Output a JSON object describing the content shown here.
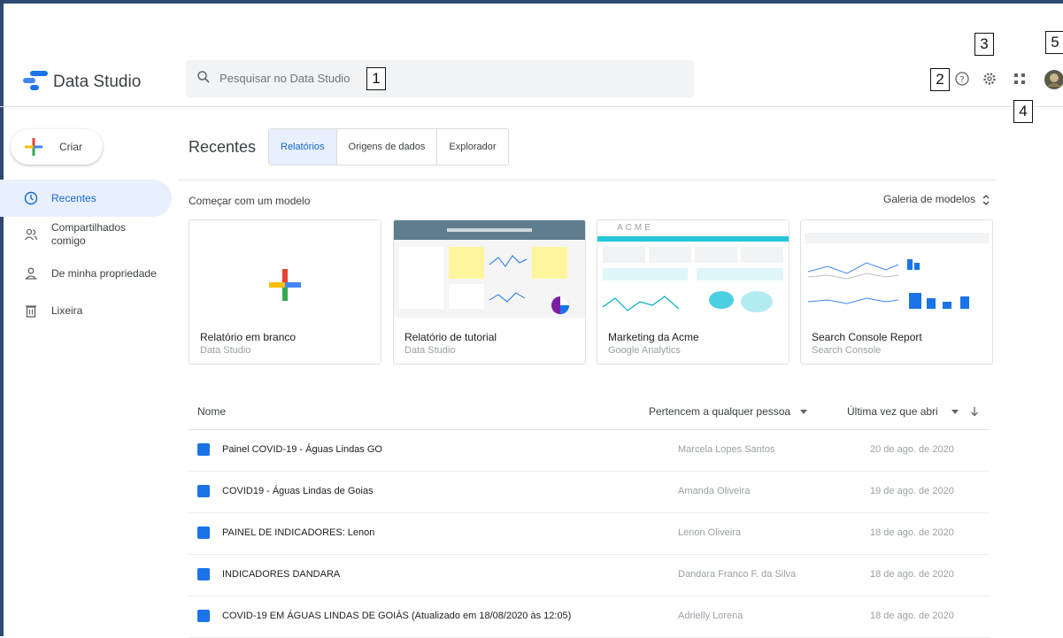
{
  "header": {
    "app_name": "Data Studio",
    "search_placeholder": "Pesquisar no Data Studio",
    "callouts": [
      "1",
      "2",
      "3",
      "4",
      "5"
    ]
  },
  "sidebar": {
    "create_label": "Criar",
    "items": [
      {
        "label": "Recentes",
        "icon": "clock-icon",
        "active": true
      },
      {
        "label": "Compartilhados comigo",
        "icon": "shared-people-icon",
        "active": false
      },
      {
        "label": "De minha propriedade",
        "icon": "person-icon",
        "active": false
      },
      {
        "label": "Lixeira",
        "icon": "trash-icon",
        "active": false
      }
    ]
  },
  "main": {
    "title": "Recentes",
    "tabs": [
      "Relatórios",
      "Origens de dados",
      "Explorador"
    ],
    "templates_label": "Começar com um modelo",
    "gallery_label": "Galeria de modelos",
    "templates": [
      {
        "name": "Relatório em branco",
        "source": "Data Studio"
      },
      {
        "name": "Relatório de tutorial",
        "source": "Data Studio"
      },
      {
        "name": "Marketing da Acme",
        "source": "Google Analytics"
      },
      {
        "name": "Search Console Report",
        "source": "Search Console"
      }
    ],
    "acme_logo": "ACME",
    "table": {
      "col_name": "Nome",
      "col_owner": "Pertencem a qualquer pessoa",
      "col_date": "Última vez que abri",
      "rows": [
        {
          "name": "Painel COVID-19 - Águas Lindas GO",
          "owner": "Marcela Lopes Santos",
          "date": "20 de ago. de 2020"
        },
        {
          "name": "COVID19 - Águas Lindas de Goias",
          "owner": "Amanda Oliveira",
          "date": "19 de ago. de 2020"
        },
        {
          "name": "PAINEL DE INDICADORES: Lenon",
          "owner": "Lenon Oliveira",
          "date": "18 de ago. de 2020"
        },
        {
          "name": "INDICADORES DANDARA",
          "owner": "Dandara Franco F. da Silva",
          "date": "18 de ago. de 2020"
        },
        {
          "name": "COVID-19 EM ÁGUAS LINDAS DE GOIÁS (Atualizado em 18/08/2020 às 12:05)",
          "owner": "Adrielly Lorena",
          "date": "18 de ago. de 2020"
        }
      ]
    }
  },
  "colors": {
    "accent": "#1a73e8",
    "active_bg": "#e8f0fe",
    "brand_green": "#34a853",
    "brand_red": "#ea4335",
    "brand_yellow": "#fbbc04"
  }
}
